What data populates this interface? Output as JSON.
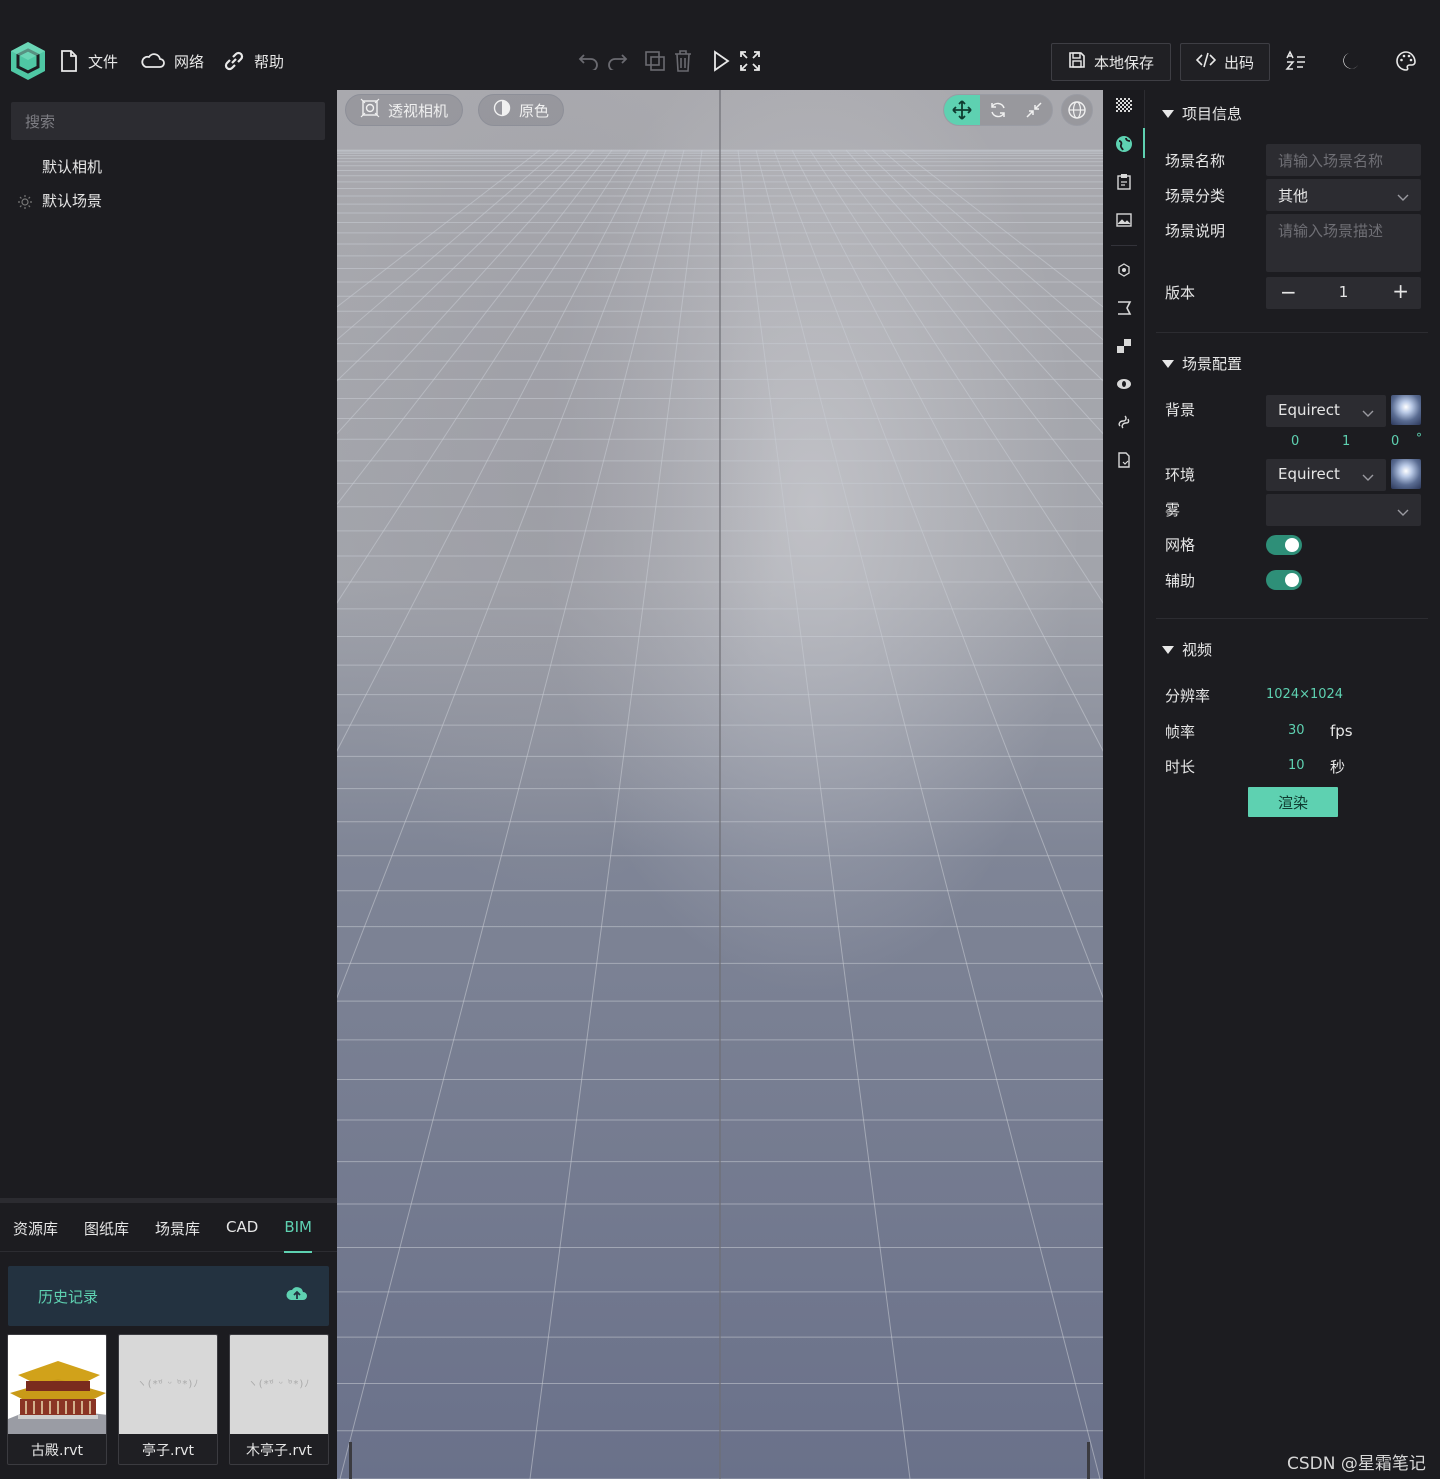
{
  "menu": {
    "file": "文件",
    "network": "网络",
    "help": "帮助"
  },
  "toolbar": {
    "save_local": "本地保存",
    "export_code": "出码"
  },
  "left": {
    "search_placeholder": "搜索",
    "tree": [
      "默认相机",
      "默认场景"
    ],
    "tabs": [
      "资源库",
      "图纸库",
      "场景库",
      "CAD",
      "BIM"
    ],
    "active_tab": "BIM",
    "history": "历史记录",
    "thumbs": [
      {
        "label": "古殿.rvt",
        "placeholder": ""
      },
      {
        "label": "亭子.rvt",
        "placeholder": "ヽ(*ᵒ᷄ ᵕ ᵒ᷅*)ﾉ"
      },
      {
        "label": "木亭子.rvt",
        "placeholder": "ヽ(*ᵒ᷄ ᵕ ᵒ᷅*)ﾉ"
      }
    ]
  },
  "viewport": {
    "camera": "透视相机",
    "color_mode": "原色"
  },
  "right": {
    "project_info": {
      "title": "项目信息",
      "scene_name_label": "场景名称",
      "scene_name_placeholder": "请输入场景名称",
      "scene_category_label": "场景分类",
      "scene_category_value": "其他",
      "scene_desc_label": "场景说明",
      "scene_desc_placeholder": "请输入场景描述",
      "version_label": "版本",
      "version_value": "1"
    },
    "scene_config": {
      "title": "场景配置",
      "background_label": "背景",
      "background_value": "Equirect",
      "rot_x": "0",
      "rot_y": "1",
      "rot_z": "0",
      "rot_unit": "°",
      "environment_label": "环境",
      "environment_value": "Equirect",
      "fog_label": "雾",
      "grid_label": "网格",
      "grid_on": true,
      "helper_label": "辅助",
      "helper_on": true
    },
    "video": {
      "title": "视频",
      "resolution_label": "分辨率",
      "resolution_value": "1024×1024",
      "fps_label": "帧率",
      "fps_value": "30",
      "fps_unit": "fps",
      "duration_label": "时长",
      "duration_value": "10",
      "duration_unit": "秒",
      "render_label": "渲染"
    }
  },
  "watermark": "CSDN @星霜笔记",
  "colors": {
    "accent": "#5ed1b1",
    "panel": "#1c1c20",
    "input": "#2c2c31"
  }
}
